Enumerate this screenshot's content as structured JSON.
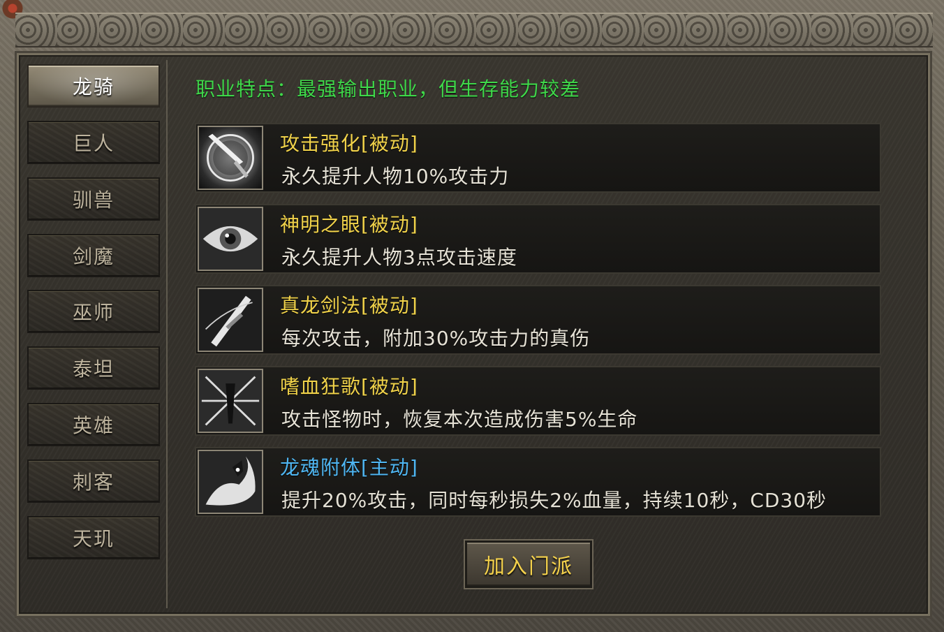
{
  "classes": [
    {
      "label": "龙骑",
      "active": true
    },
    {
      "label": "巨人",
      "active": false
    },
    {
      "label": "驯兽",
      "active": false
    },
    {
      "label": "剑魔",
      "active": false
    },
    {
      "label": "巫师",
      "active": false
    },
    {
      "label": "泰坦",
      "active": false
    },
    {
      "label": "英雄",
      "active": false
    },
    {
      "label": "刺客",
      "active": false
    },
    {
      "label": "天玑",
      "active": false
    }
  ],
  "feature_text": "职业特点：最强输出职业，但生存能力较差",
  "skills": [
    {
      "name": "攻击强化[被动]",
      "desc": "永久提升人物10%攻击力",
      "icon": "sword-orb-icon",
      "type": "passive"
    },
    {
      "name": "神明之眼[被动]",
      "desc": "永久提升人物3点攻击速度",
      "icon": "eye-icon",
      "type": "passive"
    },
    {
      "name": "真龙剑法[被动]",
      "desc": "每次攻击，附加30%攻击力的真伤",
      "icon": "blade-icon",
      "type": "passive"
    },
    {
      "name": "嗜血狂歌[被动]",
      "desc": "攻击怪物时，恢复本次造成伤害5%生命",
      "icon": "blood-burst-icon",
      "type": "passive"
    },
    {
      "name": "龙魂附体[主动]",
      "desc": "提升20%攻击，同时每秒损失2%血量，持续10秒，CD30秒",
      "icon": "dragon-soul-icon",
      "type": "active"
    }
  ],
  "join_button": "加入门派",
  "colors": {
    "feature": "#3fd84a",
    "passive_name": "#f0d24a",
    "active_name": "#4fb6f2",
    "desc": "#e6e2d6",
    "button_text": "#f5d24c"
  }
}
